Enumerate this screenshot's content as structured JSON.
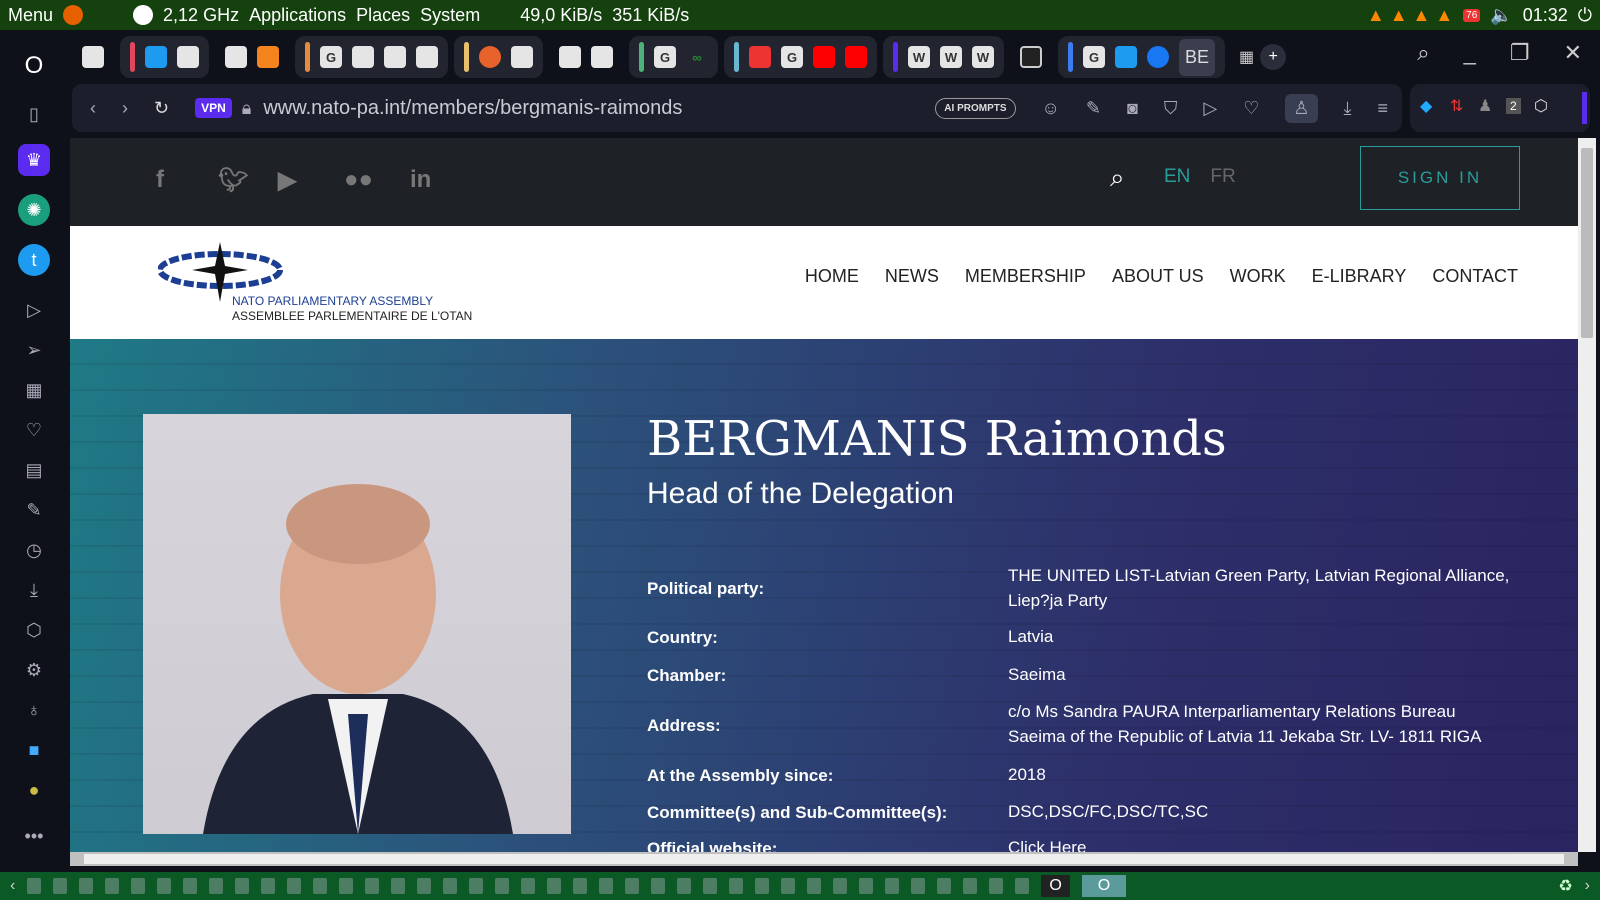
{
  "panel": {
    "menu": "Menu",
    "cpu": "2,12 GHz",
    "applications": "Applications",
    "places": "Places",
    "system": "System",
    "net_down": "49,0 KiB/s",
    "net_up": "351 KiB/s",
    "clock": "01:32",
    "notif_badge": "76"
  },
  "browser": {
    "tab_active": "BE",
    "address": "www.nato-pa.int/members/bergmanis-raimonds",
    "vpn": "VPN",
    "ai_prompts": "AI PROMPTS",
    "ext_badge": "2"
  },
  "site": {
    "lang_en": "EN",
    "lang_fr": "FR",
    "sign_in": "SIGN IN",
    "logo_line1": "NATO PARLIAMENTARY ASSEMBLY",
    "logo_line2": "ASSEMBLEE PARLEMENTAIRE DE L'OTAN",
    "nav": [
      "HOME",
      "NEWS",
      "MEMBERSHIP",
      "ABOUT US",
      "WORK",
      "E-LIBRARY",
      "CONTACT"
    ]
  },
  "member": {
    "name": "BERGMANIS Raimonds",
    "role": "Head of the Delegation",
    "rows": [
      {
        "label": "Political party:",
        "value": "THE UNITED LIST-Latvian Green Party, Latvian Regional Alliance, Liep?ja Party"
      },
      {
        "label": "Country:",
        "value": "Latvia"
      },
      {
        "label": "Chamber:",
        "value": "Saeima"
      },
      {
        "label": "Address:",
        "value": "c/o Ms Sandra PAURA Interparliamentary Relations Bureau Saeima of the Republic of Latvia 11 Jekaba Str. LV- 1811 RIGA"
      },
      {
        "label": "At the Assembly since:",
        "value": "2018"
      },
      {
        "label": "Committee(s) and Sub-Committee(s):",
        "value": "DSC,DSC/FC,DSC/TC,SC"
      },
      {
        "label": "Official website:",
        "value": "Click Here"
      }
    ]
  }
}
